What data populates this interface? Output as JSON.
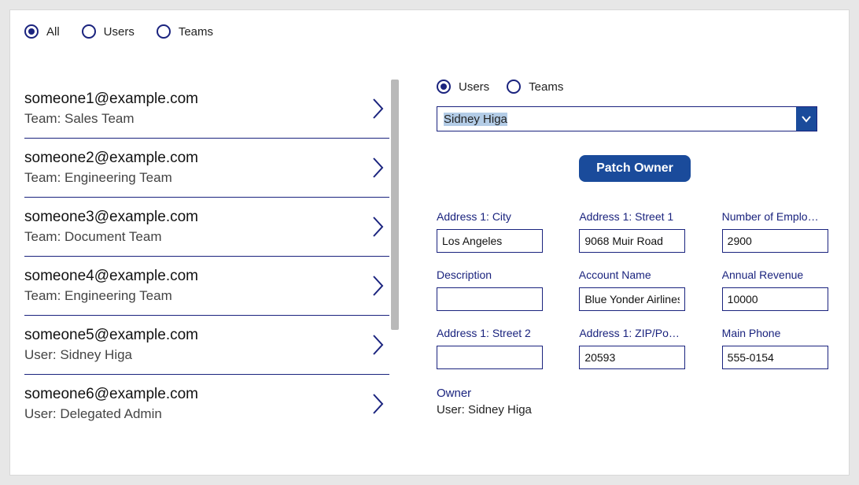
{
  "topFilter": {
    "options": [
      {
        "label": "All",
        "selected": true
      },
      {
        "label": "Users",
        "selected": false
      },
      {
        "label": "Teams",
        "selected": false
      }
    ]
  },
  "list": [
    {
      "email": "someone1@example.com",
      "sub": "Team: Sales Team"
    },
    {
      "email": "someone2@example.com",
      "sub": "Team: Engineering Team"
    },
    {
      "email": "someone3@example.com",
      "sub": "Team: Document Team"
    },
    {
      "email": "someone4@example.com",
      "sub": "Team: Engineering Team"
    },
    {
      "email": "someone5@example.com",
      "sub": "User: Sidney Higa"
    },
    {
      "email": "someone6@example.com",
      "sub": "User: Delegated Admin"
    }
  ],
  "rightFilter": {
    "options": [
      {
        "label": "Users",
        "selected": true
      },
      {
        "label": "Teams",
        "selected": false
      }
    ]
  },
  "dropdown": {
    "value": "Sidney Higa"
  },
  "patchButton": "Patch Owner",
  "fields": {
    "city": {
      "label": "Address 1: City",
      "value": "Los Angeles"
    },
    "street1": {
      "label": "Address 1: Street 1",
      "value": "9068 Muir Road"
    },
    "employees": {
      "label": "Number of Emplo…",
      "value": "2900"
    },
    "description": {
      "label": "Description",
      "value": ""
    },
    "account": {
      "label": "Account Name",
      "value": "Blue Yonder Airlines",
      "required": true
    },
    "revenue": {
      "label": "Annual Revenue",
      "value": "10000"
    },
    "street2": {
      "label": "Address 1: Street 2",
      "value": ""
    },
    "zip": {
      "label": "Address 1: ZIP/Po…",
      "value": "20593"
    },
    "phone": {
      "label": "Main Phone",
      "value": "555-0154"
    }
  },
  "owner": {
    "label": "Owner",
    "value": "User: Sidney Higa"
  }
}
